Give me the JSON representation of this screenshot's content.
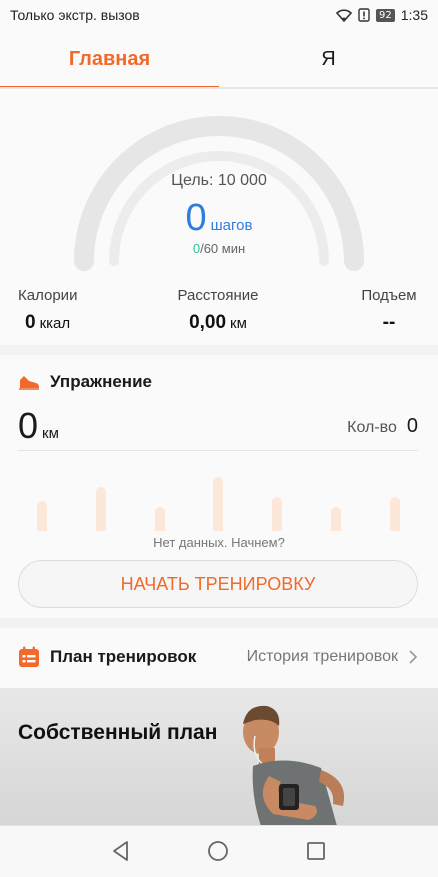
{
  "status_bar": {
    "carrier_text": "Только экстр. вызов",
    "battery": "92",
    "time": "1:35",
    "icons": [
      "wifi-icon",
      "alert-icon",
      "battery-icon"
    ]
  },
  "tabs": [
    {
      "label": "Главная",
      "active": true
    },
    {
      "label": "Я",
      "active": false
    }
  ],
  "summary": {
    "goal_label": "Цель: 10 000",
    "steps_value": "0",
    "steps_unit": "шагов",
    "active_minutes": "0",
    "minutes_goal": "/60 мин",
    "metrics": [
      {
        "label": "Калории",
        "value": "0",
        "unit": "ккал"
      },
      {
        "label": "Расстояние",
        "value": "0,00",
        "unit": "км"
      },
      {
        "label": "Подъем",
        "value": "--",
        "unit": ""
      }
    ]
  },
  "exercise": {
    "title": "Упражнение",
    "distance_value": "0",
    "distance_unit": "км",
    "count_label": "Кол-во",
    "count_value": "0",
    "no_data": "Нет данных. Начнем?",
    "start_button": "НАЧАТЬ ТРЕНИРОВКУ"
  },
  "plan": {
    "title": "План тренировок",
    "history_link": "История тренировок"
  },
  "banner": {
    "title": "Собственный план"
  },
  "colors": {
    "accent": "#f26a2b",
    "steps_blue": "#2f7de1",
    "minutes_green": "#25c6a1"
  }
}
